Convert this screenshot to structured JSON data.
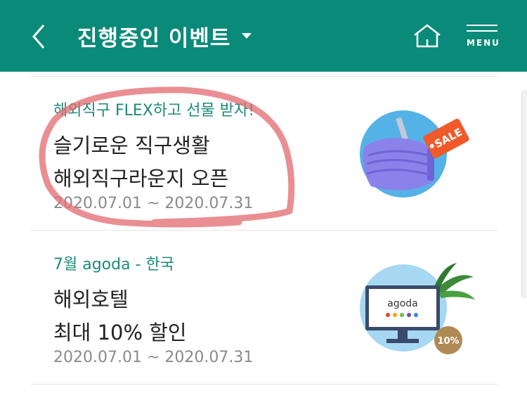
{
  "header": {
    "title": "진행중인 이벤트",
    "menu_label": "MENU"
  },
  "events": [
    {
      "subtitle": "해외직구 FLEX하고 선물 받자!",
      "line1": "슬기로운 직구생활",
      "line2": "해외직구라운지 오픈",
      "date": "2020.07.01 ~ 2020.07.31",
      "thumb_badge": "SALE"
    },
    {
      "subtitle": "7월 agoda - 한국",
      "line1": "해외호텔",
      "line2": "최대 10% 할인",
      "date": "2020.07.01 ~ 2020.07.31",
      "thumb_logo": "agoda",
      "thumb_badge": "10%"
    }
  ],
  "colors": {
    "header_bg": "#0a8a78",
    "subtitle": "#1b8a7a",
    "annotation_circle": "#e26a6f"
  },
  "icons": [
    "back-arrow-icon",
    "dropdown-caret-icon",
    "home-icon",
    "menu-icon"
  ]
}
